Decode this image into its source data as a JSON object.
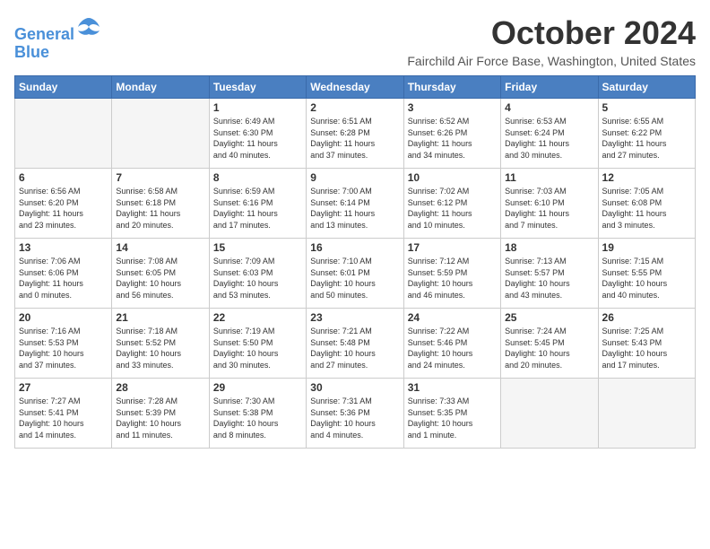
{
  "header": {
    "logo_line1": "General",
    "logo_line2": "Blue",
    "month_title": "October 2024",
    "location": "Fairchild Air Force Base, Washington, United States"
  },
  "calendar": {
    "days_of_week": [
      "Sunday",
      "Monday",
      "Tuesday",
      "Wednesday",
      "Thursday",
      "Friday",
      "Saturday"
    ],
    "weeks": [
      [
        {
          "day": "",
          "info": ""
        },
        {
          "day": "",
          "info": ""
        },
        {
          "day": "1",
          "info": "Sunrise: 6:49 AM\nSunset: 6:30 PM\nDaylight: 11 hours\nand 40 minutes."
        },
        {
          "day": "2",
          "info": "Sunrise: 6:51 AM\nSunset: 6:28 PM\nDaylight: 11 hours\nand 37 minutes."
        },
        {
          "day": "3",
          "info": "Sunrise: 6:52 AM\nSunset: 6:26 PM\nDaylight: 11 hours\nand 34 minutes."
        },
        {
          "day": "4",
          "info": "Sunrise: 6:53 AM\nSunset: 6:24 PM\nDaylight: 11 hours\nand 30 minutes."
        },
        {
          "day": "5",
          "info": "Sunrise: 6:55 AM\nSunset: 6:22 PM\nDaylight: 11 hours\nand 27 minutes."
        }
      ],
      [
        {
          "day": "6",
          "info": "Sunrise: 6:56 AM\nSunset: 6:20 PM\nDaylight: 11 hours\nand 23 minutes."
        },
        {
          "day": "7",
          "info": "Sunrise: 6:58 AM\nSunset: 6:18 PM\nDaylight: 11 hours\nand 20 minutes."
        },
        {
          "day": "8",
          "info": "Sunrise: 6:59 AM\nSunset: 6:16 PM\nDaylight: 11 hours\nand 17 minutes."
        },
        {
          "day": "9",
          "info": "Sunrise: 7:00 AM\nSunset: 6:14 PM\nDaylight: 11 hours\nand 13 minutes."
        },
        {
          "day": "10",
          "info": "Sunrise: 7:02 AM\nSunset: 6:12 PM\nDaylight: 11 hours\nand 10 minutes."
        },
        {
          "day": "11",
          "info": "Sunrise: 7:03 AM\nSunset: 6:10 PM\nDaylight: 11 hours\nand 7 minutes."
        },
        {
          "day": "12",
          "info": "Sunrise: 7:05 AM\nSunset: 6:08 PM\nDaylight: 11 hours\nand 3 minutes."
        }
      ],
      [
        {
          "day": "13",
          "info": "Sunrise: 7:06 AM\nSunset: 6:06 PM\nDaylight: 11 hours\nand 0 minutes."
        },
        {
          "day": "14",
          "info": "Sunrise: 7:08 AM\nSunset: 6:05 PM\nDaylight: 10 hours\nand 56 minutes."
        },
        {
          "day": "15",
          "info": "Sunrise: 7:09 AM\nSunset: 6:03 PM\nDaylight: 10 hours\nand 53 minutes."
        },
        {
          "day": "16",
          "info": "Sunrise: 7:10 AM\nSunset: 6:01 PM\nDaylight: 10 hours\nand 50 minutes."
        },
        {
          "day": "17",
          "info": "Sunrise: 7:12 AM\nSunset: 5:59 PM\nDaylight: 10 hours\nand 46 minutes."
        },
        {
          "day": "18",
          "info": "Sunrise: 7:13 AM\nSunset: 5:57 PM\nDaylight: 10 hours\nand 43 minutes."
        },
        {
          "day": "19",
          "info": "Sunrise: 7:15 AM\nSunset: 5:55 PM\nDaylight: 10 hours\nand 40 minutes."
        }
      ],
      [
        {
          "day": "20",
          "info": "Sunrise: 7:16 AM\nSunset: 5:53 PM\nDaylight: 10 hours\nand 37 minutes."
        },
        {
          "day": "21",
          "info": "Sunrise: 7:18 AM\nSunset: 5:52 PM\nDaylight: 10 hours\nand 33 minutes."
        },
        {
          "day": "22",
          "info": "Sunrise: 7:19 AM\nSunset: 5:50 PM\nDaylight: 10 hours\nand 30 minutes."
        },
        {
          "day": "23",
          "info": "Sunrise: 7:21 AM\nSunset: 5:48 PM\nDaylight: 10 hours\nand 27 minutes."
        },
        {
          "day": "24",
          "info": "Sunrise: 7:22 AM\nSunset: 5:46 PM\nDaylight: 10 hours\nand 24 minutes."
        },
        {
          "day": "25",
          "info": "Sunrise: 7:24 AM\nSunset: 5:45 PM\nDaylight: 10 hours\nand 20 minutes."
        },
        {
          "day": "26",
          "info": "Sunrise: 7:25 AM\nSunset: 5:43 PM\nDaylight: 10 hours\nand 17 minutes."
        }
      ],
      [
        {
          "day": "27",
          "info": "Sunrise: 7:27 AM\nSunset: 5:41 PM\nDaylight: 10 hours\nand 14 minutes."
        },
        {
          "day": "28",
          "info": "Sunrise: 7:28 AM\nSunset: 5:39 PM\nDaylight: 10 hours\nand 11 minutes."
        },
        {
          "day": "29",
          "info": "Sunrise: 7:30 AM\nSunset: 5:38 PM\nDaylight: 10 hours\nand 8 minutes."
        },
        {
          "day": "30",
          "info": "Sunrise: 7:31 AM\nSunset: 5:36 PM\nDaylight: 10 hours\nand 4 minutes."
        },
        {
          "day": "31",
          "info": "Sunrise: 7:33 AM\nSunset: 5:35 PM\nDaylight: 10 hours\nand 1 minute."
        },
        {
          "day": "",
          "info": ""
        },
        {
          "day": "",
          "info": ""
        }
      ]
    ]
  }
}
